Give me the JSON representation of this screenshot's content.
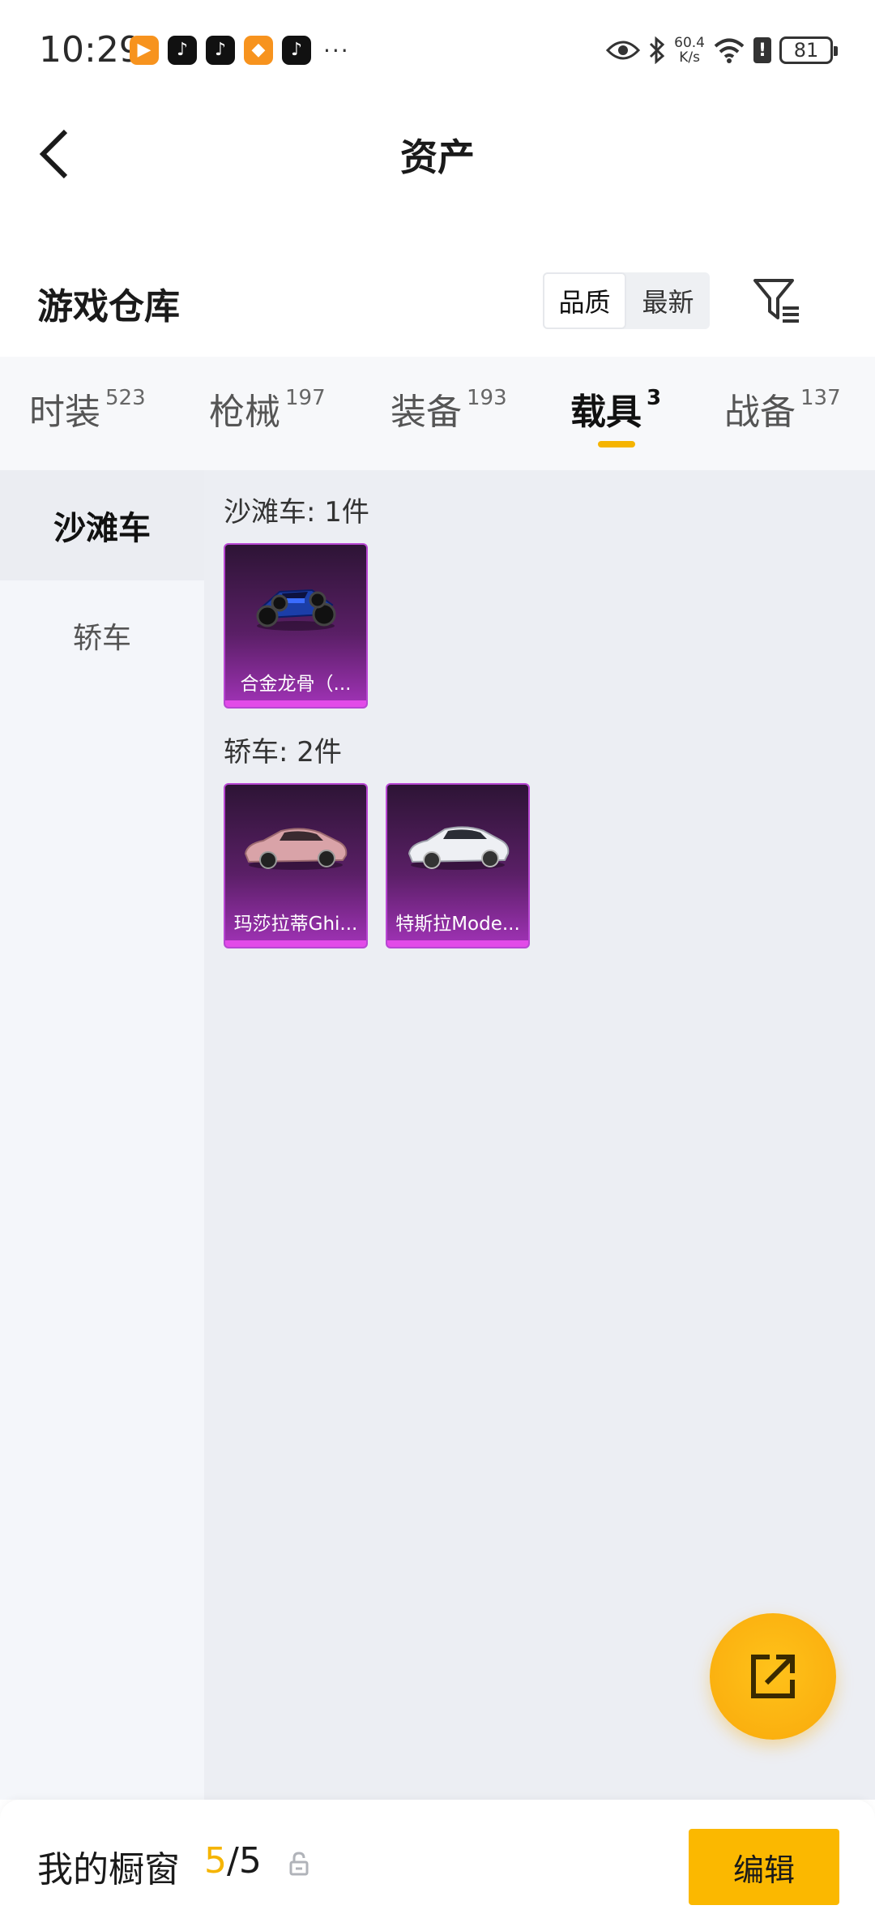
{
  "status_bar": {
    "time": "10:29",
    "net_speed_value": "60.4",
    "net_speed_unit": "K/s",
    "battery": "81",
    "more": "···"
  },
  "header": {
    "title": "资产"
  },
  "warehouse": {
    "title": "游戏仓库",
    "sort_options": [
      {
        "label": "品质",
        "selected": true
      },
      {
        "label": "最新",
        "selected": false
      }
    ]
  },
  "tabs": [
    {
      "label": "时装",
      "count": "523",
      "active": false
    },
    {
      "label": "枪械",
      "count": "197",
      "active": false
    },
    {
      "label": "装备",
      "count": "193",
      "active": false
    },
    {
      "label": "载具",
      "count": "3",
      "active": true
    },
    {
      "label": "战备",
      "count": "137",
      "active": false
    }
  ],
  "sidebar": {
    "items": [
      {
        "label": "沙滩车",
        "active": true
      },
      {
        "label": "轿车",
        "active": false
      }
    ]
  },
  "groups": [
    {
      "label": "沙滩车: 1件",
      "items": [
        {
          "name": "合金龙骨（...",
          "art": "buggy-image"
        }
      ]
    },
    {
      "label": "轿车: 2件",
      "items": [
        {
          "name": "玛莎拉蒂Ghi...",
          "art": "pink-sedan-image"
        },
        {
          "name": "特斯拉Mode...",
          "art": "white-sedan-image"
        }
      ]
    }
  ],
  "bottom_bar": {
    "showcase_label": "我的橱窗",
    "showcase_current": "5",
    "showcase_sep": "/",
    "showcase_total": "5",
    "edit_label": "编辑"
  },
  "colors": {
    "accent": "#f5b400",
    "card_purple": "#a233b8"
  }
}
